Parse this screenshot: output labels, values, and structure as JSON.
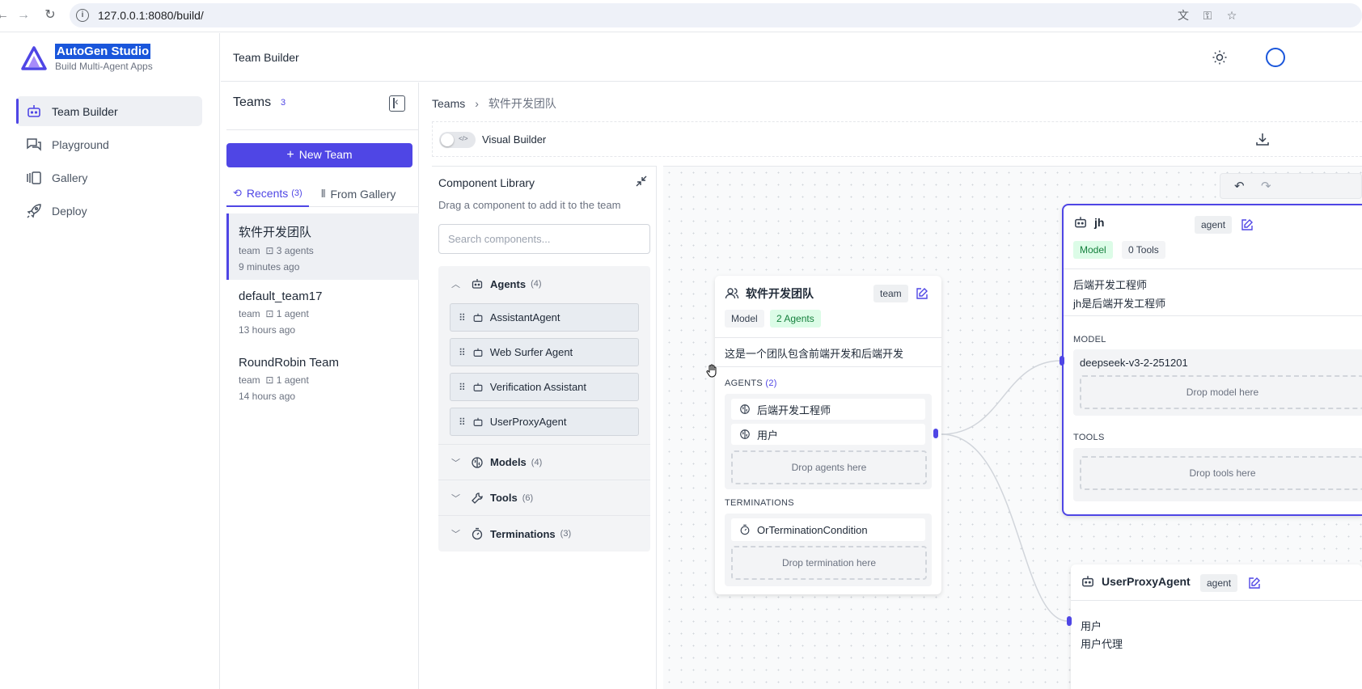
{
  "browser": {
    "url": "127.0.0.1:8080/build/"
  },
  "brand": {
    "title": "AutoGen Studio",
    "subtitle": "Build Multi-Agent Apps"
  },
  "nav": [
    {
      "label": "Team Builder"
    },
    {
      "label": "Playground"
    },
    {
      "label": "Gallery"
    },
    {
      "label": "Deploy"
    }
  ],
  "header": {
    "title": "Team Builder"
  },
  "teams": {
    "title": "Teams",
    "count": "3",
    "new_team": "New Team",
    "tabs": [
      {
        "label": "Recents",
        "count": "(3)"
      },
      {
        "label": "From Gallery"
      }
    ],
    "items": [
      {
        "name": "软件开发团队",
        "type": "team",
        "agents": "3 agents",
        "time": "9 minutes ago"
      },
      {
        "name": "default_team17",
        "type": "team",
        "agents": "1 agent",
        "time": "13 hours ago"
      },
      {
        "name": "RoundRobin Team",
        "type": "team",
        "agents": "1 agent",
        "time": "14 hours ago"
      }
    ]
  },
  "breadcrumb": {
    "root": "Teams",
    "current": "软件开发团队"
  },
  "builder": {
    "toggle_label": "Visual Builder"
  },
  "library": {
    "title": "Component Library",
    "subtitle": "Drag a component to add it to the team",
    "search_placeholder": "Search components...",
    "sections": {
      "agents": {
        "label": "Agents",
        "count": "(4)"
      },
      "models": {
        "label": "Models",
        "count": "(4)"
      },
      "tools": {
        "label": "Tools",
        "count": "(6)"
      },
      "terminations": {
        "label": "Terminations",
        "count": "(3)"
      }
    },
    "agents": [
      "AssistantAgent",
      "Web Surfer Agent",
      "Verification Assistant",
      "UserProxyAgent"
    ]
  },
  "team_node": {
    "name": "软件开发团队",
    "tag": "team",
    "model_tag": "Model",
    "agents_tag": "2 Agents",
    "description": "这是一个团队包含前端开发和后端开发",
    "agents_label": "AGENTS",
    "agents_count": "(2)",
    "agents": [
      "后端开发工程师",
      "用户"
    ],
    "drop_agents": "Drop agents here",
    "terminations_label": "TERMINATIONS",
    "termination": "OrTerminationCondition",
    "drop_termination": "Drop termination here"
  },
  "agent_node": {
    "name": "jh",
    "tag": "agent",
    "model_tag": "Model",
    "tools_tag": "0 Tools",
    "desc1": "后端开发工程师",
    "desc2": "jh是后端开发工程师",
    "model_label": "MODEL",
    "model": "deepseek-v3-2-251201",
    "drop_model": "Drop model here",
    "tools_label": "TOOLS",
    "drop_tools": "Drop tools here"
  },
  "proxy_node": {
    "name": "UserProxyAgent",
    "tag": "agent",
    "desc1": "用户",
    "desc2": "用户代理"
  },
  "colors": {
    "accent": "#4f46e5",
    "green_bg": "#dcfce7",
    "green_text": "#15803d"
  }
}
